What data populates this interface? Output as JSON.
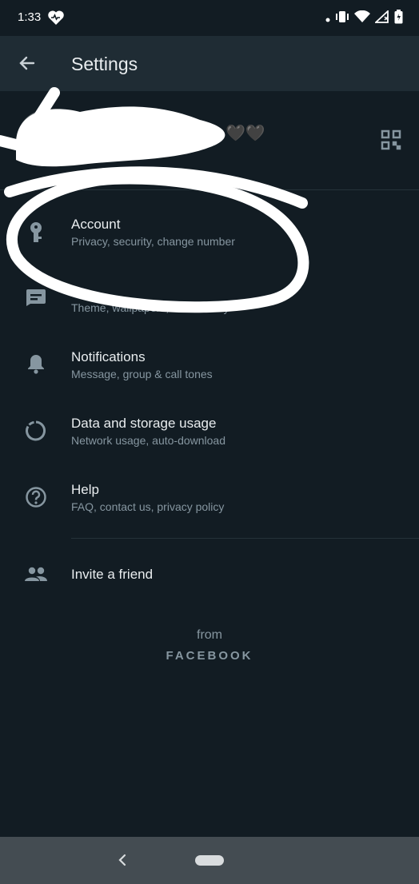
{
  "status_bar": {
    "time": "1:33",
    "icons": [
      "heart-icon",
      "dot-icon",
      "vibrate-icon",
      "wifi-icon",
      "signal-icon",
      "battery-icon"
    ]
  },
  "app_bar": {
    "title": "Settings",
    "back_icon": "arrow-left-icon"
  },
  "profile": {
    "name_visible_fragment": "🖤🖤",
    "qr_icon": "qr-code-icon"
  },
  "menu": {
    "account": {
      "title": "Account",
      "subtitle": "Privacy, security, change number",
      "icon": "key-icon"
    },
    "chats": {
      "title": "",
      "subtitle": "Theme, wallpapers, chat history",
      "icon": "chat-icon"
    },
    "notifications": {
      "title": "Notifications",
      "subtitle": "Message, group & call tones",
      "icon": "bell-icon"
    },
    "storage": {
      "title": "Data and storage usage",
      "subtitle": "Network usage, auto-download",
      "icon": "storage-circle-icon"
    },
    "help": {
      "title": "Help",
      "subtitle": "FAQ, contact us, privacy policy",
      "icon": "help-circle-icon"
    },
    "invite": {
      "title": "Invite a friend",
      "icon": "people-icon"
    }
  },
  "footer": {
    "from": "from",
    "brand": "FACEBOOK"
  },
  "nav_bar": {
    "back_icon": "chevron-left-icon",
    "home_icon": "home-pill-icon"
  },
  "colors": {
    "background": "#121c23",
    "app_bar": "#1f2c34",
    "icon_gray": "#8696a0",
    "scribble": "#ffffff"
  }
}
